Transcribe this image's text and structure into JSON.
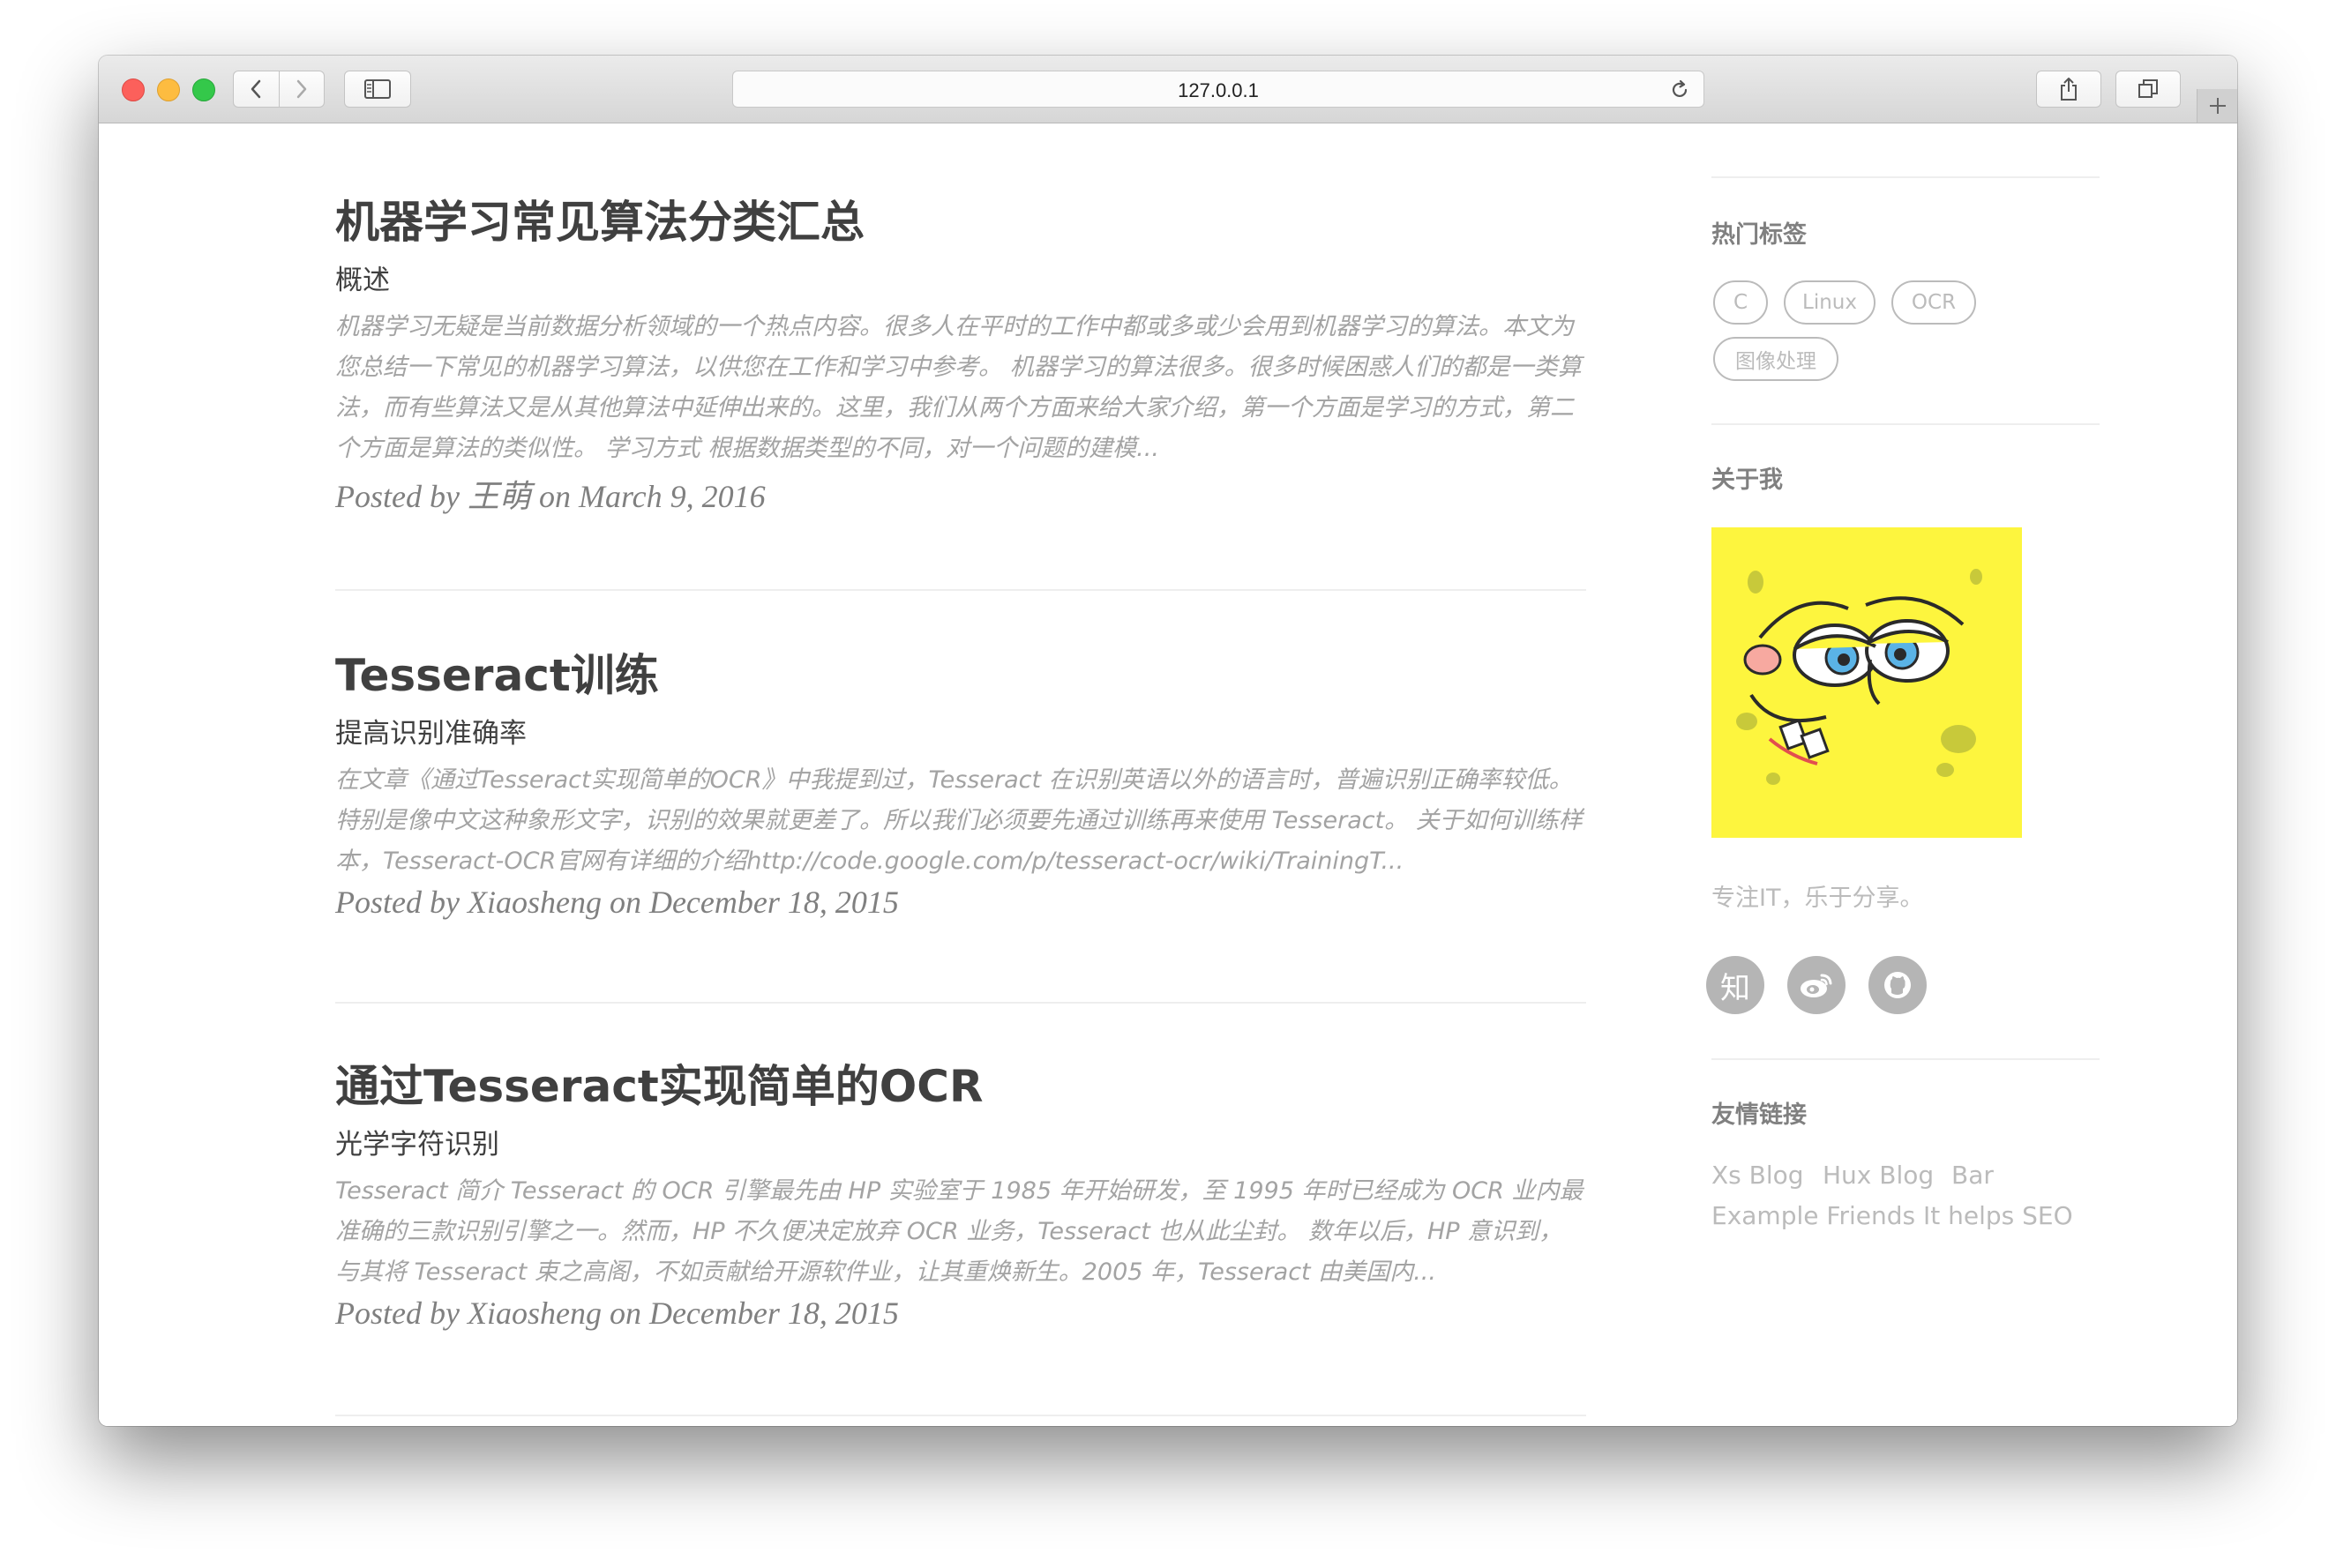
{
  "browser": {
    "url": "127.0.0.1",
    "icons": [
      "back-chevron-icon",
      "forward-chevron-icon",
      "sidebar-icon",
      "reload-icon",
      "share-icon",
      "tabs-icon",
      "plus-icon"
    ]
  },
  "posts": [
    {
      "title": "机器学习常见算法分类汇总",
      "subtitle": "概述",
      "excerpt": "机器学习无疑是当前数据分析领域的一个热点内容。很多人在平时的工作中都或多或少会用到机器学习的算法。本文为您总结一下常见的机器学习算法，以供您在工作和学习中参考。 机器学习的算法很多。很多时候困惑人们的都是一类算法，而有些算法又是从其他算法中延伸出来的。这里，我们从两个方面来给大家介绍，第一个方面是学习的方式，第二个方面是算法的类似性。 学习方式 根据数据类型的不同，对一个问题的建模...",
      "meta": "Posted by 王萌 on March 9, 2016"
    },
    {
      "title": "Tesseract训练",
      "subtitle": "提高识别准确率",
      "excerpt": "在文章《通过Tesseract实现简单的OCR》中我提到过，Tesseract 在识别英语以外的语言时，普遍识别正确率较低。特别是像中文这种象形文字，识别的效果就更差了。所以我们必须要先通过训练再来使用 Tesseract。 关于如何训练样本，Tesseract-OCR官网有详细的介绍http://code.google.com/p/tesseract-ocr/wiki/TrainingT...",
      "meta": "Posted by Xiaosheng on December 18, 2015"
    },
    {
      "title": "通过Tesseract实现简单的OCR",
      "subtitle": "光学字符识别",
      "excerpt": "Tesseract 简介 Tesseract 的 OCR 引擎最先由 HP 实验室于 1985 年开始研发，至 1995 年时已经成为 OCR 业内最准确的三款识别引擎之一。然而，HP 不久便决定放弃 OCR 业务，Tesseract 也从此尘封。 数年以后，HP 意识到，与其将 Tesseract 束之高阁，不如贡献给开源软件业，让其重焕新生。2005 年，Tesseract 由美国内...",
      "meta": "Posted by Xiaosheng on December 18, 2015"
    }
  ],
  "sidebar": {
    "tags_heading": "热门标签",
    "tags": [
      "C",
      "Linux",
      "OCR",
      "图像处理"
    ],
    "about_heading": "关于我",
    "about_text": "专注IT，乐于分享。",
    "social": [
      {
        "name": "zhihu-icon",
        "glyph": "知"
      },
      {
        "name": "weibo-icon",
        "glyph": ""
      },
      {
        "name": "github-icon",
        "glyph": ""
      }
    ],
    "friends_heading": "友情链接",
    "friends": [
      "Xs Blog",
      "Hux Blog",
      "Bar",
      "Example Friends",
      "It helps SEO"
    ]
  },
  "colors": {
    "title": "#404040",
    "excerpt": "#a3a3a3",
    "meta": "#808080",
    "muted": "#bbbbbb",
    "avatar_bg": "#fdf53e"
  }
}
